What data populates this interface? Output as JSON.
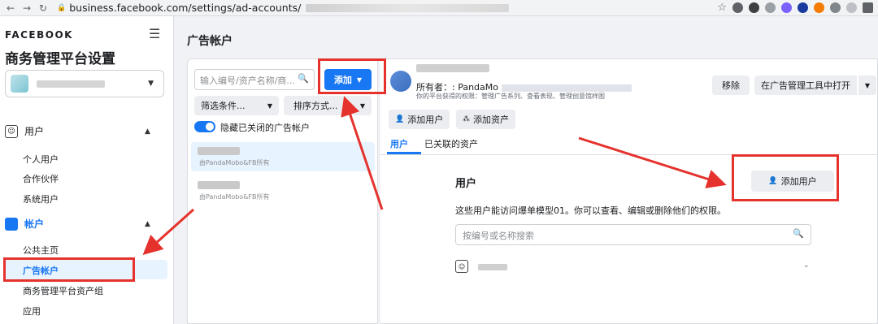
{
  "browser": {
    "url_prefix": "business.facebook.com/settings/ad-accounts/",
    "nav_icons": [
      "back-icon",
      "forward-icon",
      "reload-icon"
    ]
  },
  "sidebar": {
    "brand": "FACEBOOK",
    "title": "商务管理平台设置",
    "users_section": "用户",
    "users_items": [
      "个人用户",
      "合作伙伴",
      "系统用户"
    ],
    "accounts_section": "帐户",
    "accounts_items": [
      "公共主页",
      "广告帐户",
      "商务管理平台资产组",
      "应用"
    ]
  },
  "main": {
    "title": "广告帐户",
    "search_placeholder": "输入编号/资产名称/商...",
    "add_label": "添加",
    "filter_label": "筛选条件...",
    "sort_label": "排序方式...",
    "toggle_label": "隐藏已关闭的广告帐户",
    "items": [
      {
        "owner": "由PandaMobo&FB所有"
      },
      {
        "owner": "由PandaMobo&FB所有"
      }
    ]
  },
  "detail": {
    "owner_label": "所有者：: PandaMo",
    "permissions": "你的平台获得的权限：管理广告系列、查看表现、管理创意馆样图",
    "remove_label": "移除",
    "open_label": "在广告管理工具中打开",
    "add_user_label": "添加用户",
    "add_asset_label": "添加资产",
    "tabs": [
      "用户",
      "已关联的资产"
    ],
    "users_title": "用户",
    "users_add_label": "添加用户",
    "users_desc": "这些用户能访问爆单模型01。你可以查看、编辑或删除他们的权限。",
    "users_search_placeholder": "按编号或名称搜索"
  },
  "colors": {
    "accent": "#1877f2",
    "highlight": "#e5322d"
  }
}
